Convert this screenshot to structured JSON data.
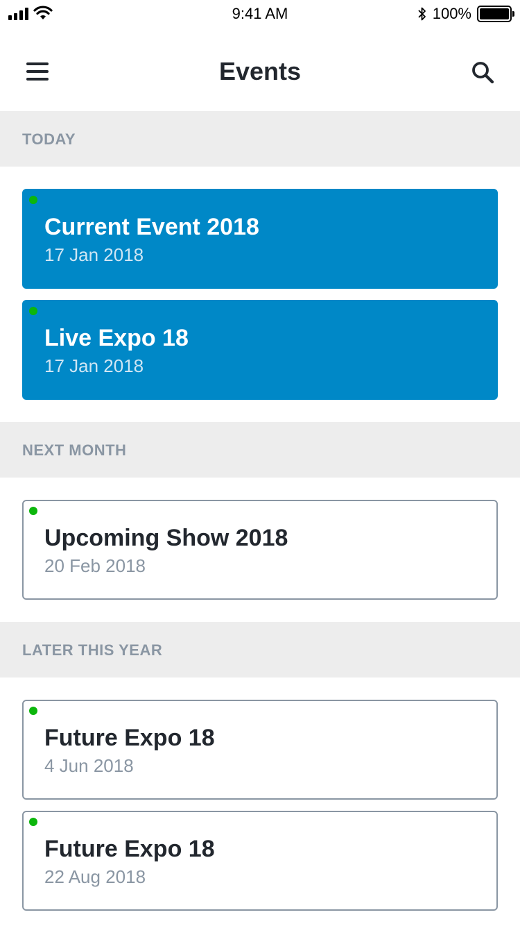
{
  "status_bar": {
    "time": "9:41 AM",
    "battery_percent": "100%",
    "icons": [
      "signal-icon",
      "wifi-icon",
      "bluetooth-icon",
      "battery-icon"
    ]
  },
  "nav": {
    "title": "Events",
    "menu_icon": "hamburger-menu-icon",
    "search_icon": "search-icon"
  },
  "sections": [
    {
      "title": "TODAY",
      "events": [
        {
          "title": "Current Event 2018",
          "date": "17 Jan 2018",
          "highlighted": true
        },
        {
          "title": "Live Expo 18",
          "date": "17 Jan 2018",
          "highlighted": true
        }
      ]
    },
    {
      "title": "NEXT MONTH",
      "events": [
        {
          "title": "Upcoming Show 2018",
          "date": "20 Feb 2018",
          "highlighted": false
        }
      ]
    },
    {
      "title": "LATER THIS YEAR",
      "events": [
        {
          "title": "Future Expo 18",
          "date": "4 Jun 2018",
          "highlighted": false
        },
        {
          "title": "Future Expo 18",
          "date": "22 Aug 2018",
          "highlighted": false
        }
      ]
    }
  ],
  "colors": {
    "accent": "#0088c7",
    "status_dot": "#0cb60c",
    "section_bg": "#ededed",
    "muted_text": "#8a96a3",
    "primary_text": "#22272e"
  }
}
